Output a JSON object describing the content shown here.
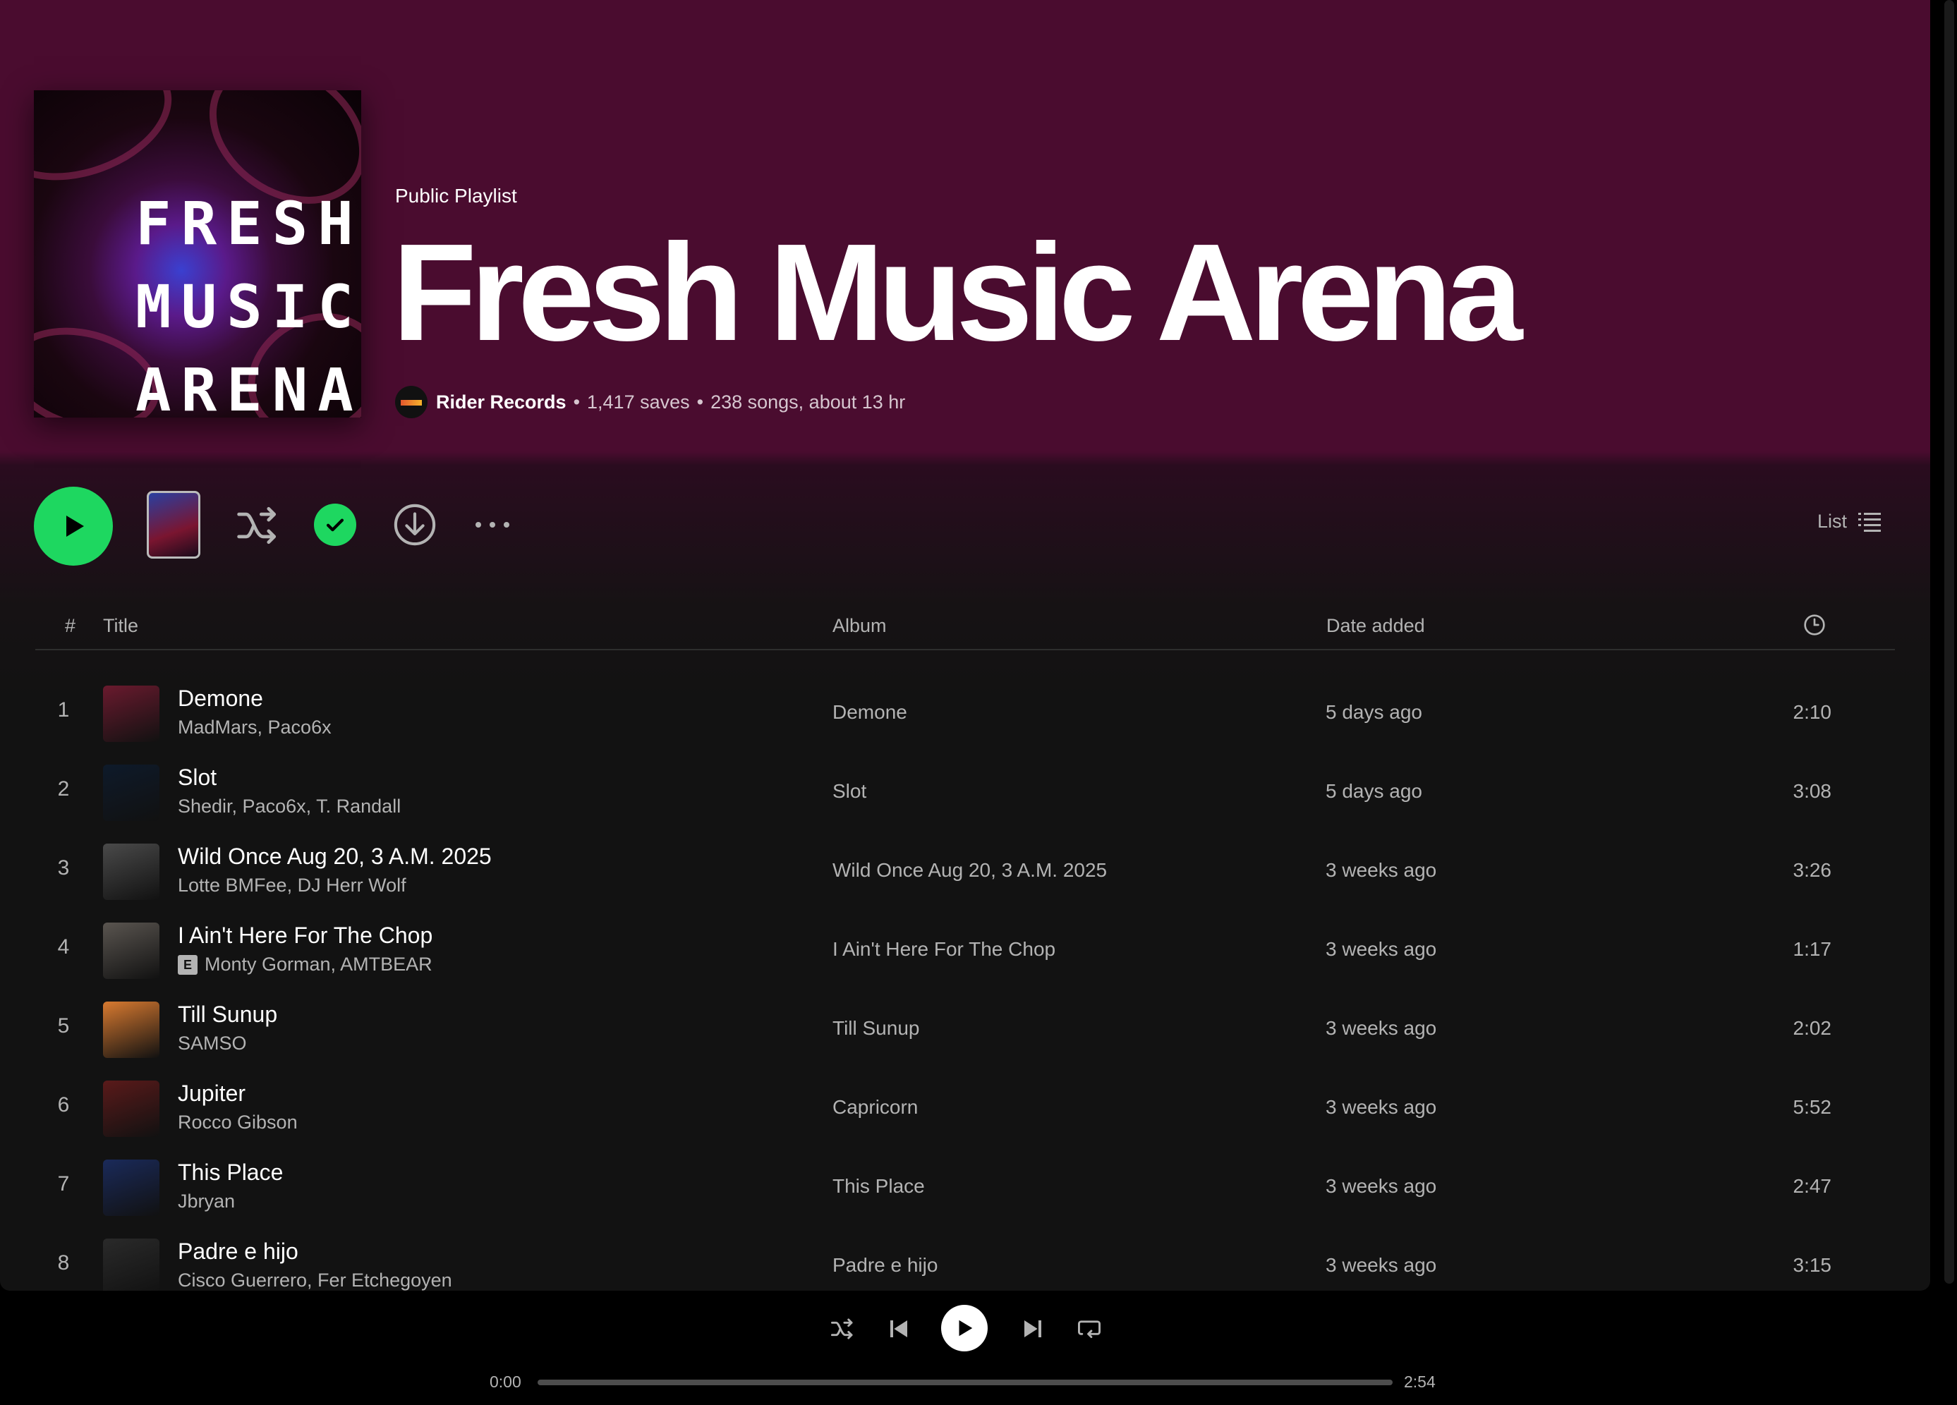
{
  "playlist": {
    "type_label": "Public Playlist",
    "title": "Fresh Music Arena",
    "cover_lines": [
      "FRESH",
      "MUSIC",
      "ARENA"
    ],
    "owner": "Rider Records",
    "saves": "1,417 saves",
    "stats": "238 songs, about 13 hr",
    "separator": "•"
  },
  "actions": {
    "play_icon": "play-icon",
    "shuffle_icon": "shuffle-icon",
    "saved_icon": "check-icon",
    "download_icon": "download-icon",
    "more_icon": "more-icon",
    "view_label": "List",
    "view_icon": "list-icon"
  },
  "table": {
    "headers": {
      "num": "#",
      "title": "Title",
      "album": "Album",
      "date_added": "Date added",
      "duration_icon": "clock-icon"
    },
    "rows": [
      {
        "num": "1",
        "title": "Demone",
        "artists": "MadMars, Paco6x",
        "explicit": false,
        "album": "Demone",
        "date": "5 days ago",
        "duration": "2:10",
        "thumb": "#6a1a2e"
      },
      {
        "num": "2",
        "title": "Slot",
        "artists": "Shedir, Paco6x, T. Randall",
        "explicit": false,
        "album": "Slot",
        "date": "5 days ago",
        "duration": "3:08",
        "thumb": "#0e1a2a"
      },
      {
        "num": "3",
        "title": "Wild Once Aug 20, 3 A.M. 2025",
        "artists": "Lotte BMFee, DJ Herr Wolf",
        "explicit": false,
        "album": "Wild Once Aug 20, 3 A.M. 2025",
        "date": "3 weeks ago",
        "duration": "3:26",
        "thumb": "#4a4a4a"
      },
      {
        "num": "4",
        "title": "I Ain't Here For The Chop",
        "artists": "Monty Gorman, AMTBEAR",
        "explicit": true,
        "explicit_label": "E",
        "album": "I Ain't Here For The Chop",
        "date": "3 weeks ago",
        "duration": "1:17",
        "thumb": "#5a5550"
      },
      {
        "num": "5",
        "title": "Till Sunup",
        "artists": "SAMSO",
        "explicit": false,
        "album": "Till Sunup",
        "date": "3 weeks ago",
        "duration": "2:02",
        "thumb": "#d87a30"
      },
      {
        "num": "6",
        "title": "Jupiter",
        "artists": "Rocco Gibson",
        "explicit": false,
        "album": "Capricorn",
        "date": "3 weeks ago",
        "duration": "5:52",
        "thumb": "#5a1a1a"
      },
      {
        "num": "7",
        "title": "This Place",
        "artists": "Jbryan",
        "explicit": false,
        "album": "This Place",
        "date": "3 weeks ago",
        "duration": "2:47",
        "thumb": "#1a2a5a"
      },
      {
        "num": "8",
        "title": "Padre e hijo",
        "artists": "Cisco Guerrero, Fer Etchegoyen",
        "explicit": false,
        "album": "Padre e hijo",
        "date": "3 weeks ago",
        "duration": "3:15",
        "thumb": "#2a2a2a"
      }
    ]
  },
  "player": {
    "current_time": "0:00",
    "total_time": "2:54",
    "progress_fraction": 0.0,
    "icons": [
      "shuffle-icon",
      "previous-icon",
      "play-icon",
      "next-icon",
      "repeat-icon"
    ]
  },
  "colors": {
    "accent": "#1ed760",
    "header_bg": "#4a0c2f",
    "body_bg": "#121212"
  }
}
